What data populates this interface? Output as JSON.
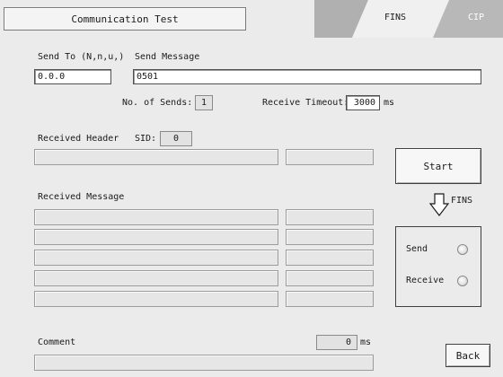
{
  "header": {
    "title": "Communication Test"
  },
  "tabs": [
    {
      "label": "FINS",
      "active": true
    },
    {
      "label": "CIP",
      "active": false
    }
  ],
  "send": {
    "send_to_label": "Send To (N,n,u,)",
    "send_to_value": "0.0.0",
    "message_label": "Send Message",
    "message_value": "0501",
    "num_sends_label": "No. of Sends:",
    "num_sends_value": "1",
    "timeout_label": "Receive Timeout:",
    "timeout_value": "3000",
    "timeout_unit": "ms"
  },
  "received_header": {
    "label": "Received Header",
    "sid_label": "SID:",
    "sid_value": "0"
  },
  "received_message": {
    "label": "Received Message"
  },
  "controls": {
    "start_label": "Start",
    "protocol_label": "FINS"
  },
  "status": {
    "send_label": "Send",
    "receive_label": "Receive"
  },
  "comment": {
    "label": "Comment",
    "value": "0",
    "unit": "ms"
  },
  "footer": {
    "back_label": "Back"
  },
  "colors": {
    "background": "#ebebeb",
    "tab_active": "#f0f0f0",
    "tab_inactive": "#b5b5b5",
    "tab_text_inactive": "#ffffff"
  }
}
